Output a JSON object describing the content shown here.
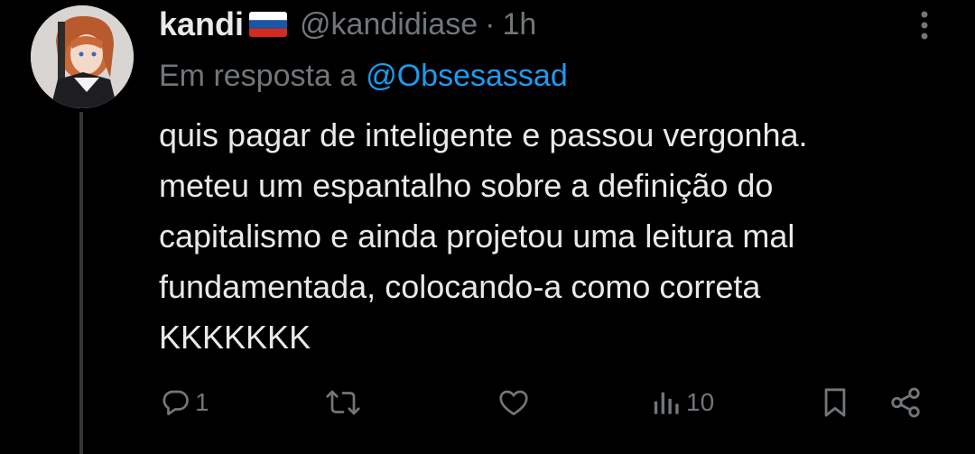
{
  "tweet": {
    "author": {
      "display_name": "kandi",
      "flag": "russia-flag",
      "handle": "@kandidiase",
      "separator": "·",
      "time": "1h"
    },
    "reply_to": {
      "prefix": "Em resposta a",
      "mention": "@Obsesassad"
    },
    "text_lines": [
      "quis pagar de inteligente e passou vergonha.",
      "meteu um espantalho sobre a definição do",
      "capitalismo e ainda projetou uma leitura mal",
      "fundamentada, colocando-a como correta",
      "KKKKKKK"
    ],
    "actions": {
      "reply_count": "1",
      "repost_count": "",
      "like_count": "",
      "views_count": "10"
    }
  },
  "colors": {
    "background": "#000000",
    "text_primary": "#e7e9ea",
    "text_secondary": "#71767b",
    "accent": "#1d9bf0",
    "thread_line": "#333639"
  }
}
